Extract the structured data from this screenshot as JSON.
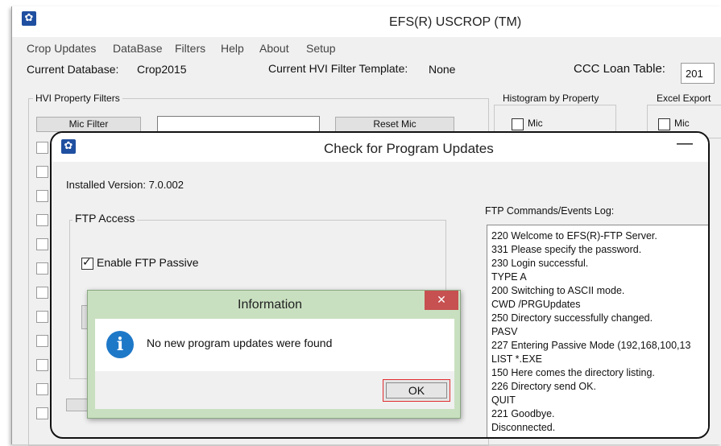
{
  "main_window": {
    "title": "EFS(R) USCROP (TM)",
    "menu": [
      "Crop Updates",
      "DataBase",
      "Filters",
      "Help",
      "About",
      "Setup"
    ],
    "current_db_label": "Current Database:",
    "current_db_value": "Crop2015",
    "hvi_template_label": "Current HVI Filter Template:",
    "hvi_template_value": "None",
    "loan_table_label": "CCC Loan Table:",
    "loan_table_value": "201",
    "hvi_filters_title": "HVI Property Filters",
    "mic_filter_button": "Mic Filter",
    "reset_mic_button": "Reset Mic",
    "histogram_title": "Histogram by Property",
    "histogram_mic": "Mic",
    "excel_title": "Excel Export",
    "excel_mic": "Mic"
  },
  "dialog": {
    "title": "Check for Program Updates",
    "minimize_glyph": "—",
    "installed_version_label": "Installed Version: 7.0.002",
    "ftp_access_title": "FTP Access",
    "enable_passive_label": "Enable FTP Passive",
    "enable_passive_checked": true,
    "log_title": "FTP Commands/Events Log:",
    "log_lines": [
      "220 Welcome to EFS(R)-FTP Server.",
      "331 Please specify the password.",
      "230 Login successful.",
      "TYPE A",
      "200 Switching to ASCII mode.",
      "CWD /PRGUpdates",
      "250 Directory successfully changed.",
      "PASV",
      "227 Entering Passive Mode (192,168,100,13",
      "LIST *.EXE",
      "150 Here comes the directory listing.",
      "226 Directory send OK.",
      "QUIT",
      "221 Goodbye.",
      "Disconnected."
    ]
  },
  "info_dialog": {
    "title": "Information",
    "close_glyph": "✕",
    "message": "No new program updates were found",
    "ok_label": "OK",
    "icon_glyph": "i"
  },
  "colors": {
    "info_titlebar": "#c9e0c0",
    "close_red": "#c75050",
    "info_icon_blue": "#1e78c8",
    "ok_highlight": "#e03030"
  }
}
